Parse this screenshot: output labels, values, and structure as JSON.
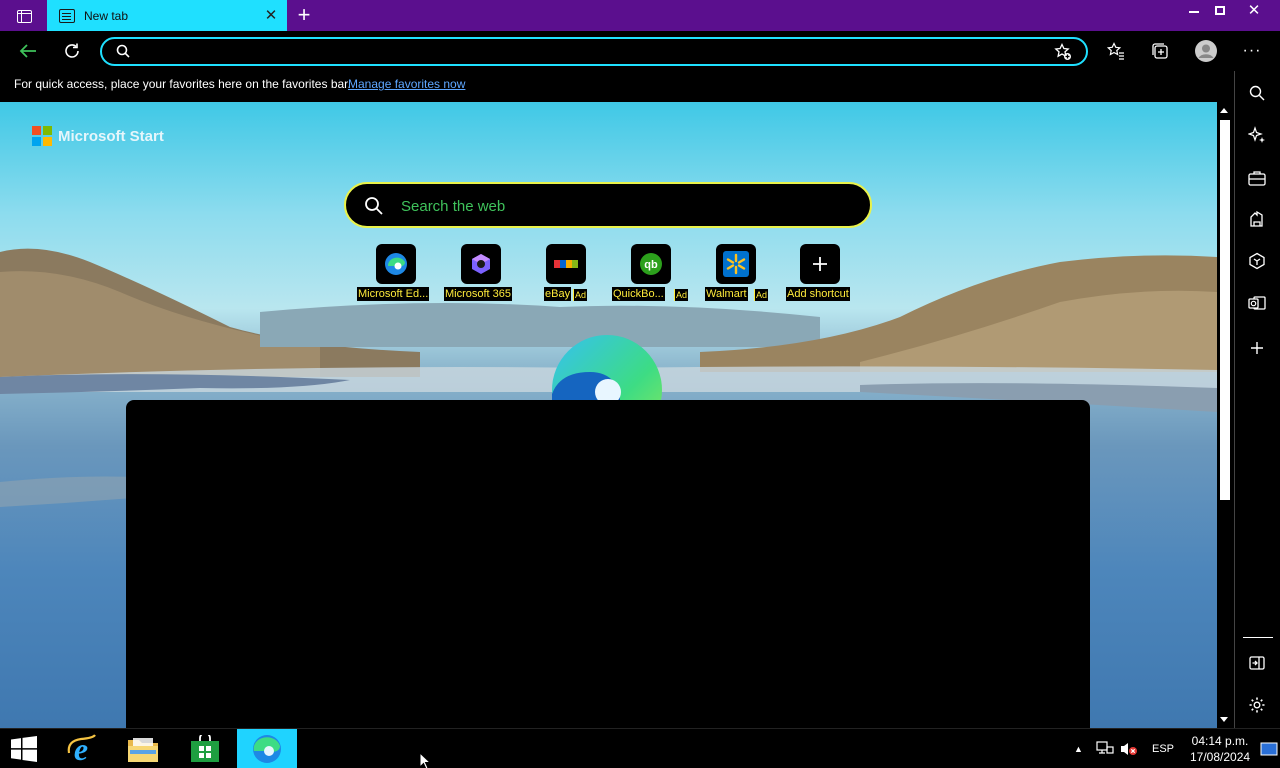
{
  "browser": {
    "tab": {
      "title": "New tab"
    },
    "address_bar": {
      "value": "",
      "placeholder": ""
    },
    "favorites_bar": {
      "message": "For quick access, place your favorites here on the favorites bar.",
      "link": "Manage favorites now"
    }
  },
  "new_tab_page": {
    "brand": "Microsoft Start",
    "search": {
      "placeholder": "Search the web"
    },
    "shortcuts": [
      {
        "label": "Microsoft Ed...",
        "icon": "edge-icon"
      },
      {
        "label": "Microsoft 365",
        "icon": "m365-icon"
      },
      {
        "label": "eBay",
        "ad": "Ad",
        "icon": "ebay-icon"
      },
      {
        "label": "QuickBo...",
        "ad": "Ad",
        "icon": "quickbooks-icon"
      },
      {
        "label": "Walmart",
        "ad": "Ad",
        "icon": "walmart-icon"
      },
      {
        "label": "Add shortcut",
        "icon": "plus-icon"
      }
    ]
  },
  "sidebar": [
    "search-icon",
    "copilot-icon",
    "tools-icon",
    "games-icon",
    "office-icon",
    "outlook-icon",
    "add-icon",
    "hide-sidebar-icon",
    "settings-icon"
  ],
  "taskbar": {
    "apps": [
      "start-icon",
      "internet-explorer-icon",
      "file-explorer-icon",
      "store-icon",
      "edge-icon"
    ],
    "language": "ESP",
    "time": "04:14 p.m.",
    "date": "17/08/2024"
  },
  "colors": {
    "titlebar": "#5b0f8e",
    "tab_active": "#1fe0ff",
    "address_border": "#1fe0ff",
    "search_border": "#e9f24a",
    "search_placeholder": "#3fc25b",
    "link": "#5ea7ff",
    "shortcut_label": "#ffeb3b"
  }
}
